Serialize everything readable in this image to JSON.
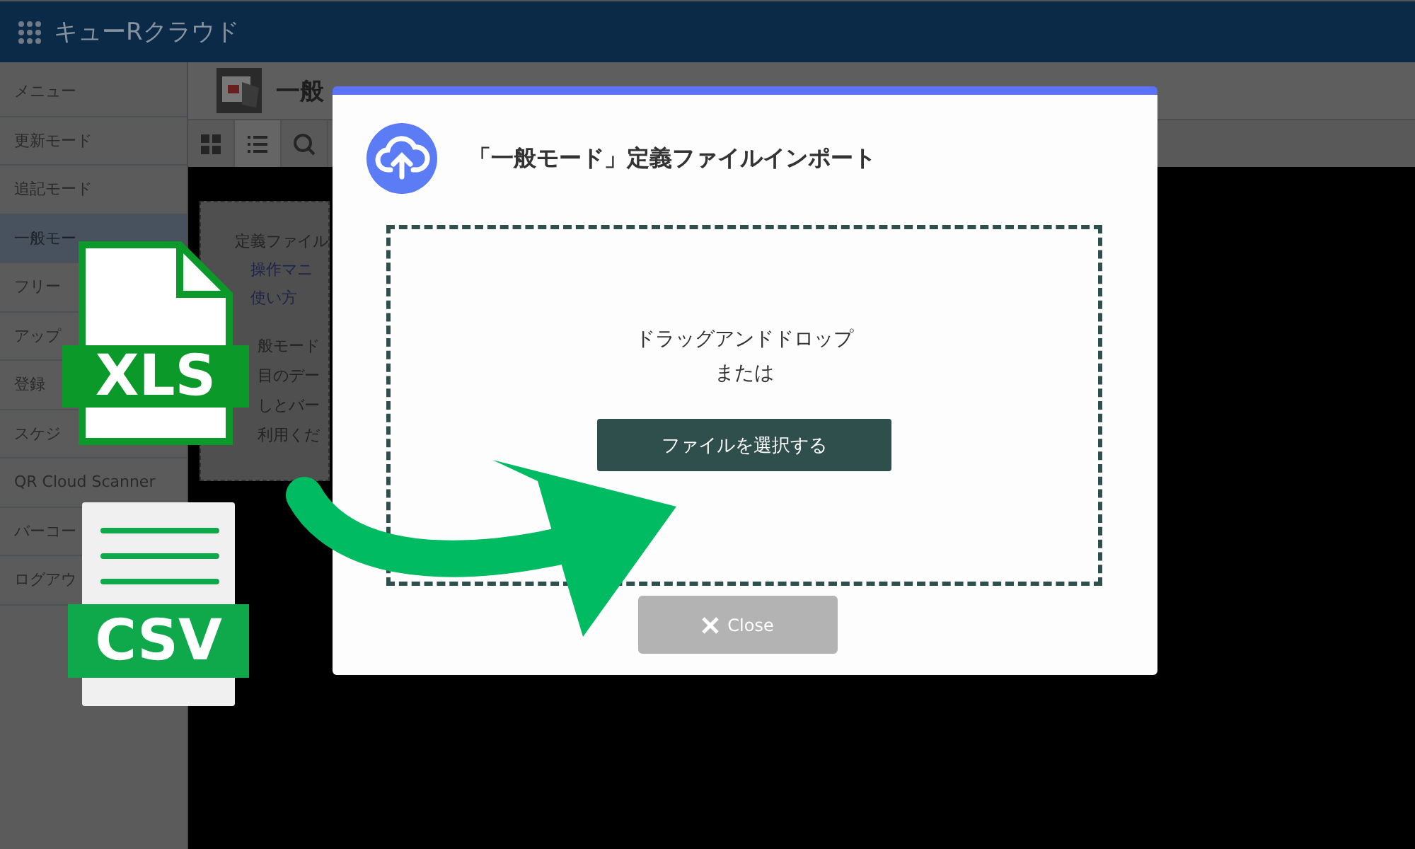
{
  "header": {
    "title": "キューRクラウド"
  },
  "sidebar": {
    "items": [
      {
        "label": "メニュー",
        "selected": false
      },
      {
        "label": "更新モード",
        "selected": false
      },
      {
        "label": "追記モード",
        "selected": false
      },
      {
        "label": "一般モー",
        "selected": true
      },
      {
        "label": "フリー",
        "selected": false
      },
      {
        "label": "アップ",
        "selected": false
      },
      {
        "label": "登録",
        "selected": false
      },
      {
        "label": "スケジ",
        "selected": false
      },
      {
        "label": "QR Cloud Scanner",
        "selected": false
      },
      {
        "label": "バーコー",
        "selected": false
      },
      {
        "label": "ログアウ",
        "selected": false
      }
    ]
  },
  "page": {
    "title": "一般",
    "view_buttons": [
      {
        "kind": "grid",
        "selected": false
      },
      {
        "kind": "list",
        "selected": true
      },
      {
        "kind": "search",
        "selected": false
      }
    ]
  },
  "info_card": {
    "title": "定義ファイル",
    "links": [
      "操作マニ",
      "使い方"
    ],
    "lines": [
      "般モード",
      "目のデー",
      "しとバー",
      "利用くだ"
    ]
  },
  "dialog": {
    "title": "「一般モード」定義ファイルインポート",
    "drop_text": [
      "ドラッグアンドドロップ",
      "または"
    ],
    "select_button": "ファイルを選択する",
    "close_button": "Close"
  },
  "file_badges": [
    {
      "kind": "xls",
      "label": "XLS"
    },
    {
      "kind": "csv",
      "label": "CSV"
    }
  ]
}
